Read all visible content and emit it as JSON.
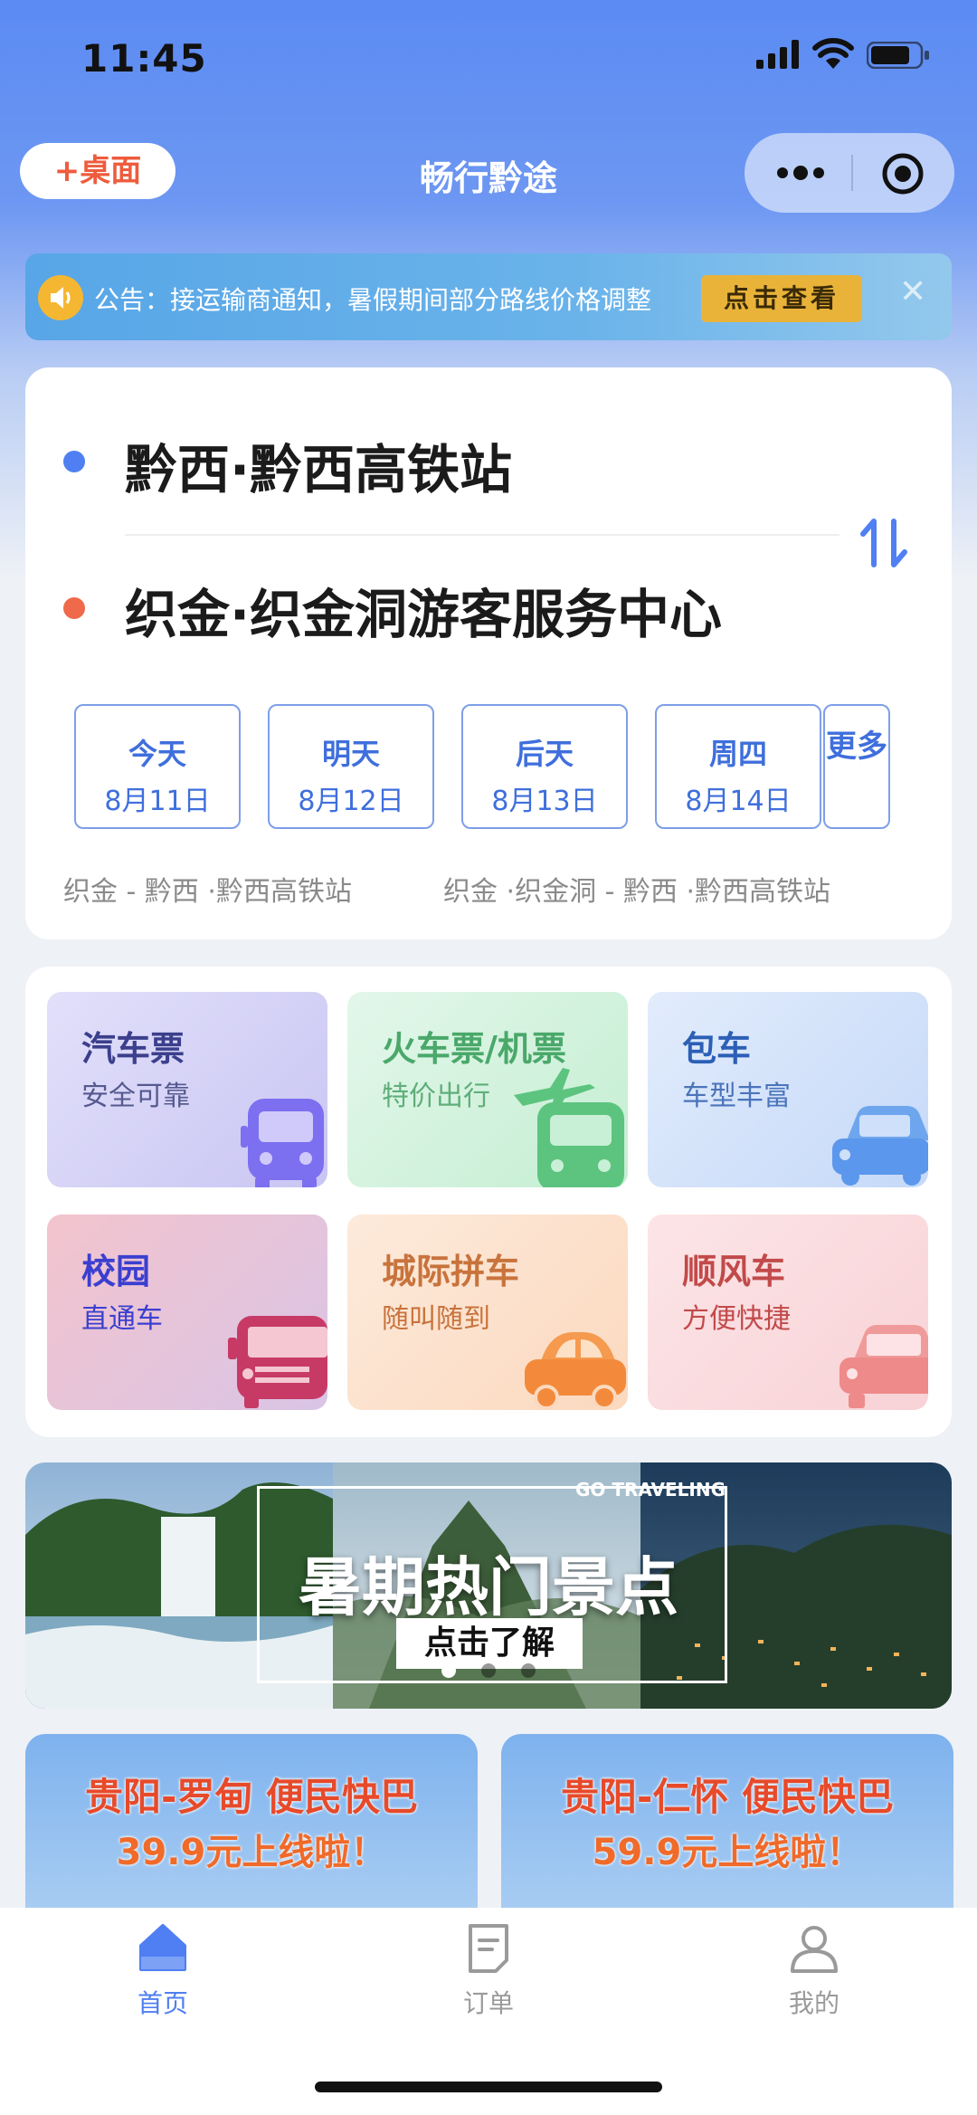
{
  "status_bar": {
    "time": "11:45"
  },
  "nav": {
    "add_desktop": "+桌面",
    "title": "畅行黔途"
  },
  "notice": {
    "text": "公告：接运输商通知，暑假期间部分路线价格调整",
    "button": "点击查看",
    "close": "✕"
  },
  "route": {
    "from": "黔西·黔西高铁站",
    "to": "织金·织金洞游客服务中心",
    "dates": [
      {
        "day": "今天",
        "date": "8月11日"
      },
      {
        "day": "明天",
        "date": "8月12日"
      },
      {
        "day": "后天",
        "date": "8月13日"
      },
      {
        "day": "周四",
        "date": "8月14日"
      }
    ],
    "more": "更多",
    "history": [
      "织金 - 黔西 ·黔西高铁站",
      "织金 ·织金洞 - 黔西 ·黔西高铁站"
    ]
  },
  "services": [
    {
      "title": "汽车票",
      "subtitle": "安全可靠",
      "icon": "bus-icon",
      "title_color": "#3b3f8c",
      "bg": [
        "#d8d6f7",
        "#c9c6f3"
      ]
    },
    {
      "title": "火车票/机票",
      "subtitle": "特价出行",
      "icon": "train-plane-icon",
      "title_color": "#4aa86a",
      "bg": [
        "#dff5e6",
        "#c9efd6"
      ]
    },
    {
      "title": "包车",
      "subtitle": "车型丰富",
      "icon": "car-icon",
      "title_color": "#2c5fb6",
      "bg": [
        "#dbe7fb",
        "#c8dbf8"
      ]
    },
    {
      "title": "校园",
      "subtitle": "直通车",
      "icon": "school-bus-icon",
      "title_color": "#3b3fd0",
      "bg": [
        "#f1c8d2",
        "#e3c3e3"
      ]
    },
    {
      "title": "城际拼车",
      "subtitle": "随叫随到",
      "icon": "carpool-car-icon",
      "title_color": "#c8733c",
      "bg": [
        "#fde8d6",
        "#fbdcc4"
      ]
    },
    {
      "title": "顺风车",
      "subtitle": "方便快捷",
      "icon": "rideshare-car-icon",
      "title_color": "#c24a4a",
      "bg": [
        "#fbe1e3",
        "#f8d0d4"
      ]
    }
  ],
  "banner": {
    "tag": "GO TRAVELING",
    "headline": "暑期热门景点",
    "cta": "点击了解",
    "slides": 3,
    "active_slide": 0
  },
  "promos": [
    {
      "line1": "贵阳-罗甸 便民快巴",
      "line2": "39.9元上线啦！"
    },
    {
      "line1": "贵阳-仁怀 便民快巴",
      "line2": "59.9元上线啦！"
    }
  ],
  "tabbar": {
    "items": [
      {
        "label": "首页",
        "icon": "home-icon",
        "active": true
      },
      {
        "label": "订单",
        "icon": "order-icon",
        "active": false
      },
      {
        "label": "我的",
        "icon": "profile-icon",
        "active": false
      }
    ],
    "active_color": "#4f7ff2",
    "inactive_color": "#9a9a9a"
  }
}
